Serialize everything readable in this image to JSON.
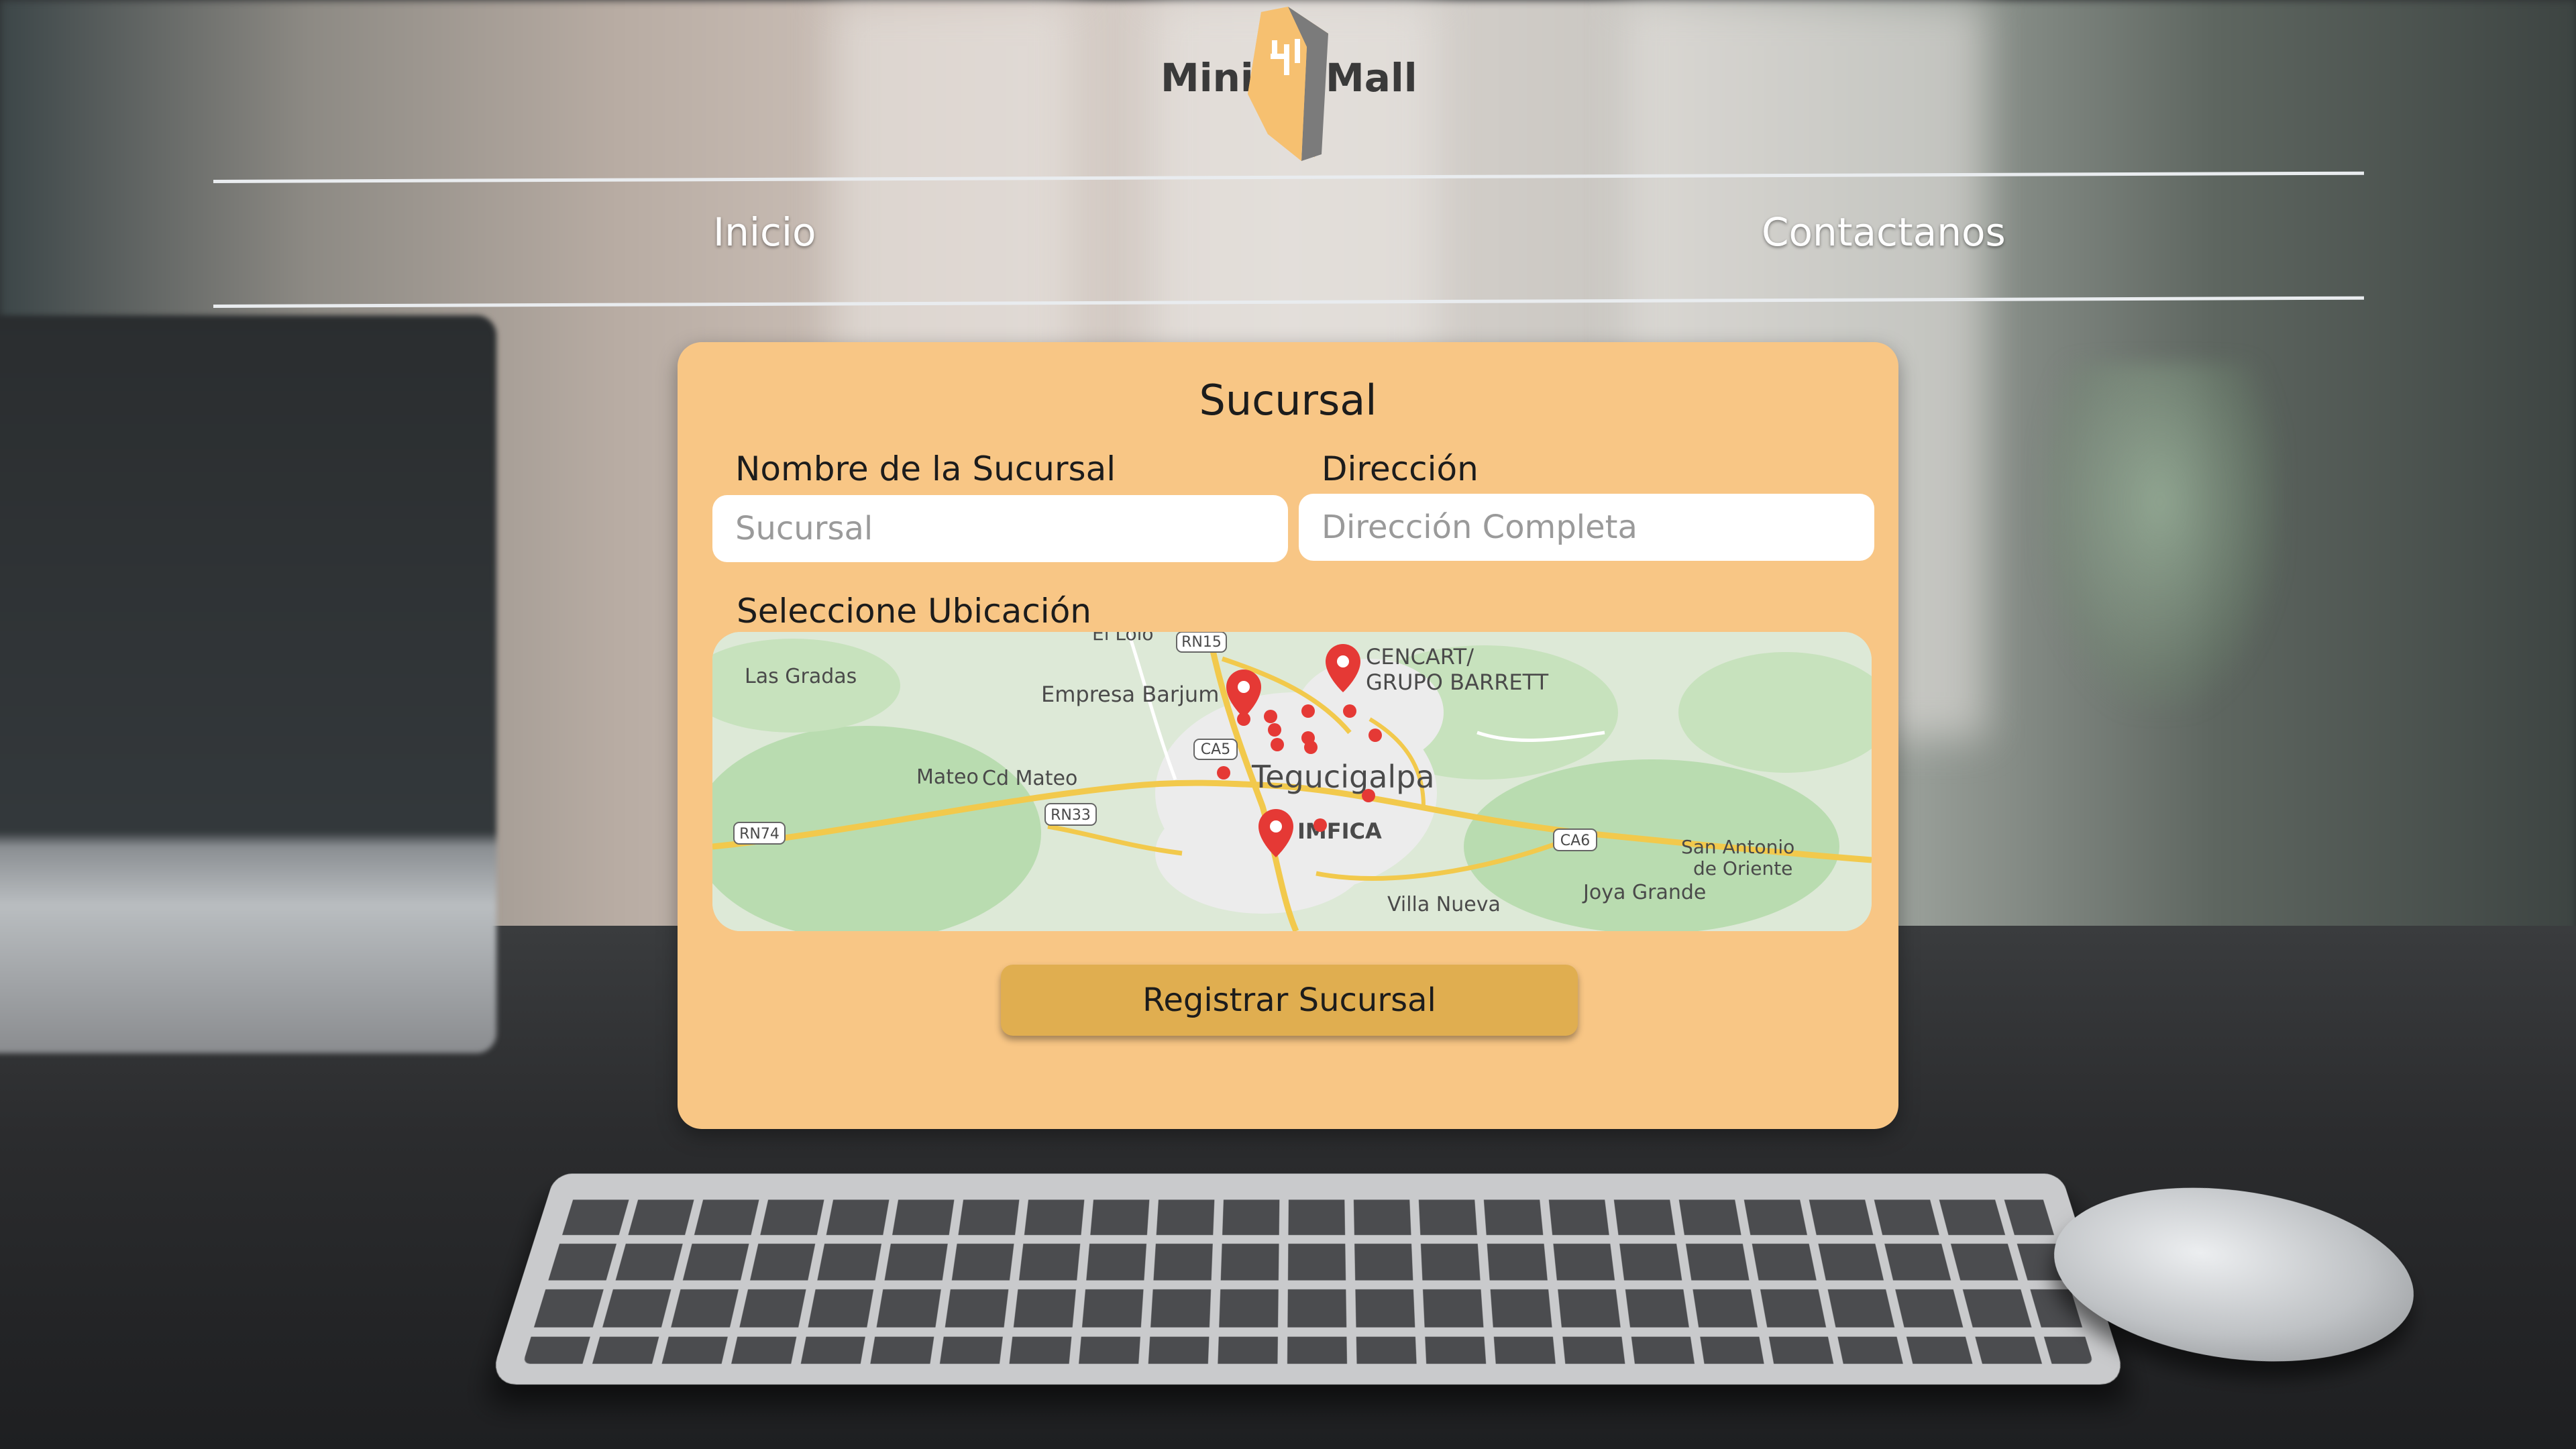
{
  "brand": {
    "left_word": "Mini",
    "right_word": "Mall",
    "logo_icon": "building-icon",
    "colors": {
      "logo_light": "#f6c070",
      "logo_dark": "#7b7b7b"
    }
  },
  "nav": {
    "items": [
      {
        "label": "Inicio"
      },
      {
        "label": "Contactanos"
      }
    ]
  },
  "form": {
    "title": "Sucursal",
    "name_label": "Nombre de la Sucursal",
    "name_placeholder": "Sucursal",
    "address_label": "Dirección",
    "address_placeholder": "Dirección Completa",
    "map_label": "Seleccione Ubicación",
    "submit_label": "Registrar Sucursal",
    "colors": {
      "card": "#f8c685",
      "button": "#e0ae50"
    }
  },
  "map": {
    "city": "Tegucigalpa",
    "places": [
      {
        "label": "Las Gradas"
      },
      {
        "label": "El Lolo"
      },
      {
        "label": "Empresa Barjum"
      },
      {
        "label": "CENCART/"
      },
      {
        "label": "GRUPO BARRETT"
      },
      {
        "label": "Mateo"
      },
      {
        "label": "Cd Mateo"
      },
      {
        "label": "IMFICA"
      },
      {
        "label": "San Antonio"
      },
      {
        "label": "de Oriente"
      },
      {
        "label": "Joya Grande"
      },
      {
        "label": "Villa Nueva"
      }
    ],
    "routes": [
      {
        "label": "RN15"
      },
      {
        "label": "CA5"
      },
      {
        "label": "RN33"
      },
      {
        "label": "RN74"
      },
      {
        "label": "CA6"
      }
    ],
    "pin_icon": "map-pin-icon",
    "colors": {
      "pin": "#e53935",
      "road": "#f2c94c",
      "park": "#b9dcb0"
    }
  }
}
